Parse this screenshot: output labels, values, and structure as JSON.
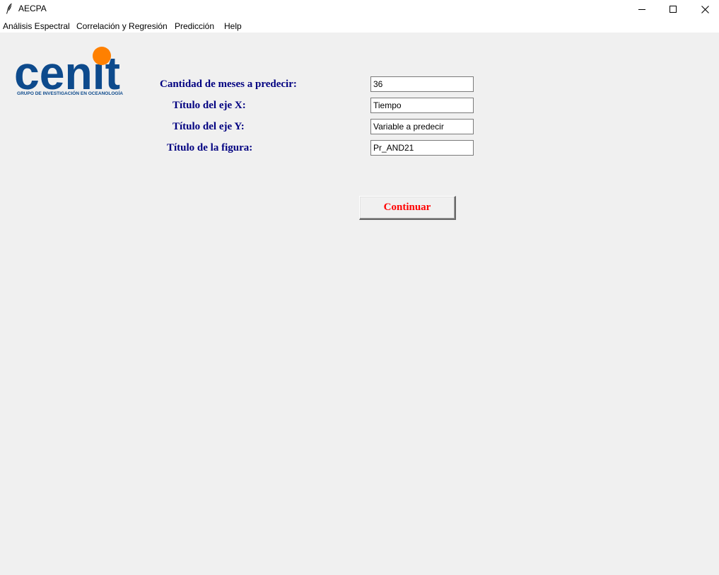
{
  "window": {
    "title": "AECPA",
    "icon": "feather-icon",
    "controls": [
      "minimize-icon",
      "maximize-icon",
      "close-icon"
    ]
  },
  "menu": {
    "items": [
      {
        "label": "Análisis Espectral"
      },
      {
        "label": "Correlación y Regresión"
      },
      {
        "label": "Predicción"
      },
      {
        "label": "Help"
      }
    ]
  },
  "logo": {
    "text": "cenit",
    "subtitle": "GRUPO DE INVESTIGACIÓN EN OCEANOLOGÍA",
    "colors": {
      "primary": "#0d4a8c",
      "accent": "#ff8000"
    }
  },
  "form": {
    "fields": [
      {
        "label": "Cantidad de meses a predecir:",
        "value": "36"
      },
      {
        "label": "Título del eje X:",
        "value": "Tiempo"
      },
      {
        "label": "Título del eje Y:",
        "value": "Variable a predecir"
      },
      {
        "label": "Título de la figura:",
        "value": "Pr_AND21"
      }
    ],
    "submit_label": "Continuar"
  },
  "colors": {
    "label": "#000080",
    "button_text": "#ff0000",
    "background": "#f0f0f0"
  }
}
